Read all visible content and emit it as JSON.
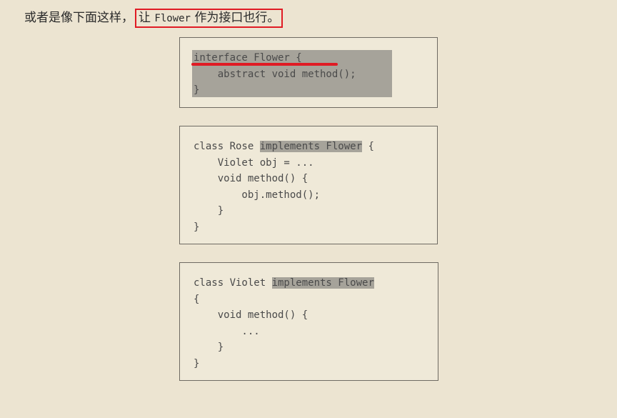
{
  "intro": {
    "prefix": "或者是像下面这样，",
    "highlight_pre": "让",
    "highlight_code": "Flower",
    "highlight_post": "作为接口也行。"
  },
  "box1": {
    "lines": [
      "interface Flower {",
      "    abstract void method();",
      "}"
    ]
  },
  "box2": {
    "line1_pre": "class Rose ",
    "line1_hl": "implements Flower",
    "line1_post": " {",
    "lines": [
      "    Violet obj = ...",
      "    void method() {",
      "        obj.method();",
      "    }",
      "}"
    ]
  },
  "box3": {
    "line1_pre": "class Violet ",
    "line1_hl": "implements Flower",
    "lines": [
      "{",
      "    void method() {",
      "        ...",
      "    }",
      "}"
    ]
  },
  "colors": {
    "highlight_border": "#e01b24",
    "code_shade": "#a6a39a",
    "background": "#ece4d1"
  }
}
